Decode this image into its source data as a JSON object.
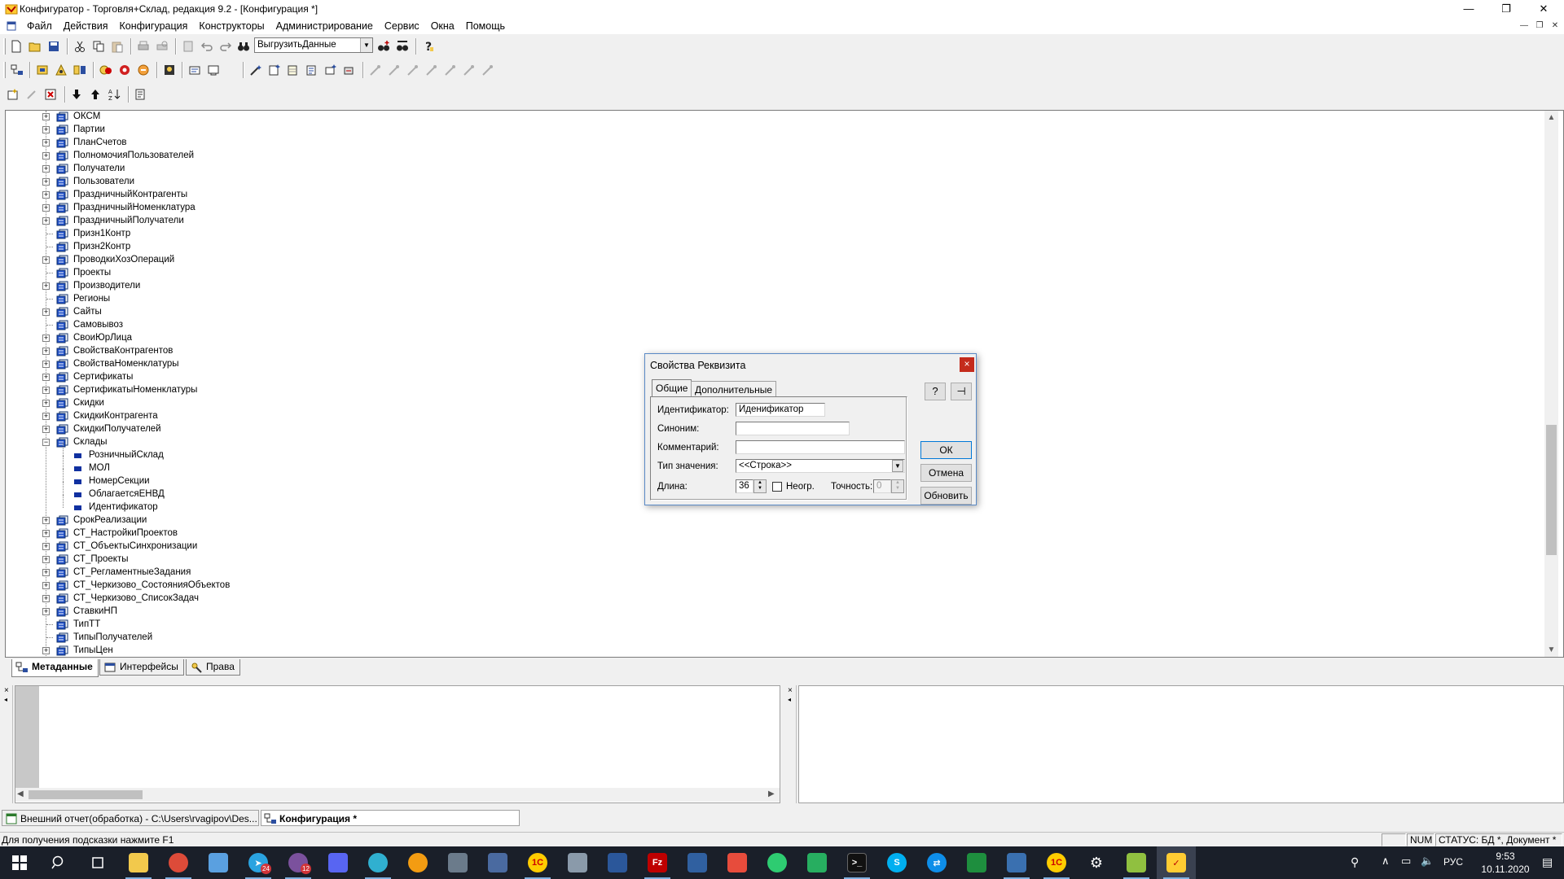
{
  "window": {
    "title": "Конфигуратор - Торговля+Склад, редакция 9.2 - [Конфигурация *]",
    "minimize": "—",
    "restore": "❐",
    "close": "✕"
  },
  "menu": {
    "items": [
      "Файл",
      "Действия",
      "Конфигурация",
      "Конструкторы",
      "Администрирование",
      "Сервис",
      "Окна",
      "Помощь"
    ]
  },
  "toolbar": {
    "combo_value": "ВыгрузитьДанные"
  },
  "tree": {
    "items": [
      {
        "label": "ОКСМ",
        "level": 0,
        "expander": "+",
        "icon": "folder-gear"
      },
      {
        "label": "Партии",
        "level": 0,
        "expander": "+",
        "icon": "folder-gear"
      },
      {
        "label": "ПланСчетов",
        "level": 0,
        "expander": "+",
        "icon": "folder-gear"
      },
      {
        "label": "ПолномочияПользователей",
        "level": 0,
        "expander": "+",
        "icon": "folder-gear"
      },
      {
        "label": "Получатели",
        "level": 0,
        "expander": "+",
        "icon": "folder-gear"
      },
      {
        "label": "Пользователи",
        "level": 0,
        "expander": "+",
        "icon": "folder-gear"
      },
      {
        "label": "ПраздничныйКонтрагенты",
        "level": 0,
        "expander": "+",
        "icon": "folder-gear"
      },
      {
        "label": "ПраздничныйНоменклатура",
        "level": 0,
        "expander": "+",
        "icon": "folder-gear"
      },
      {
        "label": "ПраздничныйПолучатели",
        "level": 0,
        "expander": "+",
        "icon": "folder-gear"
      },
      {
        "label": "Призн1Контр",
        "level": 0,
        "expander": "",
        "icon": "folder-gear"
      },
      {
        "label": "Призн2Контр",
        "level": 0,
        "expander": "",
        "icon": "folder-gear"
      },
      {
        "label": "ПроводкиХозОпераций",
        "level": 0,
        "expander": "+",
        "icon": "folder-gear"
      },
      {
        "label": "Проекты",
        "level": 0,
        "expander": "",
        "icon": "folder-gear"
      },
      {
        "label": "Производители",
        "level": 0,
        "expander": "+",
        "icon": "folder-gear"
      },
      {
        "label": "Регионы",
        "level": 0,
        "expander": "",
        "icon": "folder-gear"
      },
      {
        "label": "Сайты",
        "level": 0,
        "expander": "+",
        "icon": "folder-gear"
      },
      {
        "label": "Самовывоз",
        "level": 0,
        "expander": "",
        "icon": "folder-gear"
      },
      {
        "label": "СвоиЮрЛица",
        "level": 0,
        "expander": "+",
        "icon": "folder-gear"
      },
      {
        "label": "СвойстваКонтрагентов",
        "level": 0,
        "expander": "+",
        "icon": "folder-gear"
      },
      {
        "label": "СвойстваНоменклатуры",
        "level": 0,
        "expander": "+",
        "icon": "folder-gear"
      },
      {
        "label": "Сертификаты",
        "level": 0,
        "expander": "+",
        "icon": "folder-gear"
      },
      {
        "label": "СертификатыНоменклатуры",
        "level": 0,
        "expander": "+",
        "icon": "folder-gear"
      },
      {
        "label": "Скидки",
        "level": 0,
        "expander": "+",
        "icon": "folder-gear"
      },
      {
        "label": "СкидкиКонтрагента",
        "level": 0,
        "expander": "+",
        "icon": "folder-gear"
      },
      {
        "label": "СкидкиПолучателей",
        "level": 0,
        "expander": "+",
        "icon": "folder-gear"
      },
      {
        "label": "Склады",
        "level": 0,
        "expander": "−",
        "icon": "folder-gear"
      },
      {
        "label": "РозничныйСклад",
        "level": 1,
        "expander": "",
        "icon": "attribute"
      },
      {
        "label": "МОЛ",
        "level": 1,
        "expander": "",
        "icon": "attribute"
      },
      {
        "label": "НомерСекции",
        "level": 1,
        "expander": "",
        "icon": "attribute"
      },
      {
        "label": "ОблагаетсяЕНВД",
        "level": 1,
        "expander": "",
        "icon": "attribute"
      },
      {
        "label": "Идентификатор",
        "level": 1,
        "expander": "",
        "icon": "attribute"
      },
      {
        "label": "СрокРеализации",
        "level": 0,
        "expander": "+",
        "icon": "folder-gear"
      },
      {
        "label": "СТ_НастройкиПроектов",
        "level": 0,
        "expander": "+",
        "icon": "folder-gear"
      },
      {
        "label": "СТ_ОбъектыСинхронизации",
        "level": 0,
        "expander": "+",
        "icon": "folder-gear"
      },
      {
        "label": "СТ_Проекты",
        "level": 0,
        "expander": "+",
        "icon": "folder-gear"
      },
      {
        "label": "СТ_РегламентныеЗадания",
        "level": 0,
        "expander": "+",
        "icon": "folder-gear"
      },
      {
        "label": "СТ_Черкизово_СостоянияОбъектов",
        "level": 0,
        "expander": "+",
        "icon": "folder-gear"
      },
      {
        "label": "СТ_Черкизово_СписокЗадач",
        "level": 0,
        "expander": "+",
        "icon": "folder-gear"
      },
      {
        "label": "СтавкиНП",
        "level": 0,
        "expander": "+",
        "icon": "folder-gear"
      },
      {
        "label": "ТипТТ",
        "level": 0,
        "expander": "",
        "icon": "folder-gear"
      },
      {
        "label": "ТипыПолучателей",
        "level": 0,
        "expander": "",
        "icon": "folder-gear"
      },
      {
        "label": "ТипыЦен",
        "level": 0,
        "expander": "+",
        "icon": "folder-gear"
      }
    ]
  },
  "tabs": [
    {
      "label": "Метаданные",
      "active": true,
      "icon": "metadata-icon"
    },
    {
      "label": "Интерфейсы",
      "active": false,
      "icon": "interfaces-icon"
    },
    {
      "label": "Права",
      "active": false,
      "icon": "rights-icon"
    }
  ],
  "dialog": {
    "title": "Свойства Реквизита",
    "close": "×",
    "tabs": [
      "Общие",
      "Дополнительные"
    ],
    "fields": {
      "identifier_label": "Идентификатор:",
      "identifier_value": "Иденификатор",
      "synonym_label": "Синоним:",
      "synonym_value": "",
      "comment_label": "Комментарий:",
      "comment_value": "",
      "type_label": "Тип значения:",
      "type_value": "<<Строка>>",
      "length_label": "Длина:",
      "length_value": "36",
      "unlimited_label": "Неогр.",
      "precision_label": "Точность:",
      "precision_value": "0"
    },
    "buttons": {
      "ok": "ОК",
      "cancel": "Отмена",
      "refresh": "Обновить"
    }
  },
  "windowbar": {
    "items": [
      {
        "label": "Внешний отчет(обработка) - C:\\Users\\rvagipov\\Des...",
        "active": false
      },
      {
        "label": "Конфигурация *",
        "active": true
      }
    ]
  },
  "statusbar": {
    "hint": "Для получения подсказки нажмите F1",
    "num": "NUM",
    "status": "СТАТУС: БД *, Документ *"
  },
  "taskbar": {
    "tray_lang": "РУС",
    "time": "9:53",
    "date": "10.11.2020",
    "telegram_badge": "24",
    "viber_badge": "12"
  },
  "colors": {
    "tree_icon_blue": "#2050c8",
    "attribute_blue": "#1030a0",
    "dialog_border": "#5a8ac6",
    "close_red": "#c42b1c",
    "taskbar_bg": "#1a1f29"
  }
}
